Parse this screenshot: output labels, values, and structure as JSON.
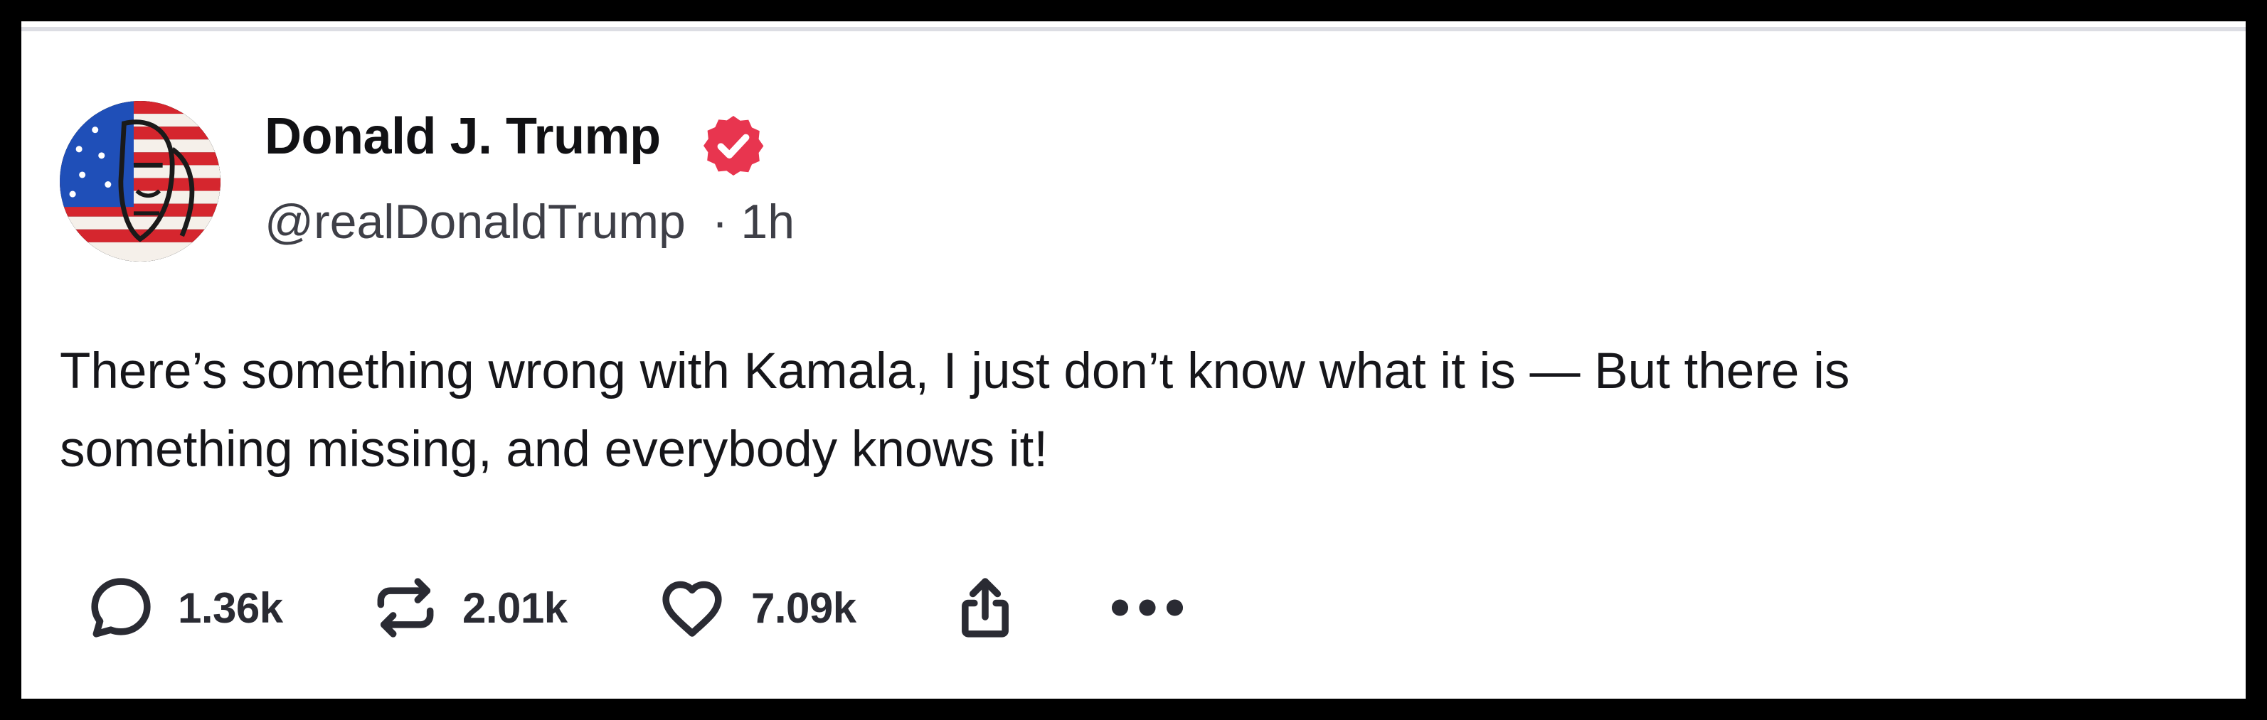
{
  "post": {
    "author": {
      "display_name": "Donald J. Trump",
      "handle": "@realDonaldTrump",
      "separator": "·",
      "time_ago": "1h",
      "verified": true,
      "verified_color": "#e8354f"
    },
    "text_lines": [
      "There’s something wrong with Kamala, I just don’t know what it is — But there is",
      "something missing, and everybody knows it!"
    ],
    "actions": {
      "replies": {
        "icon": "reply-icon",
        "count": "1.36k"
      },
      "reposts": {
        "icon": "repost-icon",
        "count": "2.01k"
      },
      "likes": {
        "icon": "heart-icon",
        "count": "7.09k"
      },
      "share": {
        "icon": "share-icon"
      },
      "more": {
        "icon": "more-icon"
      }
    }
  },
  "colors": {
    "text": "#16161a",
    "secondary_text": "#3e3f47",
    "icon": "#2a2b33",
    "frame_border": "#000000"
  }
}
